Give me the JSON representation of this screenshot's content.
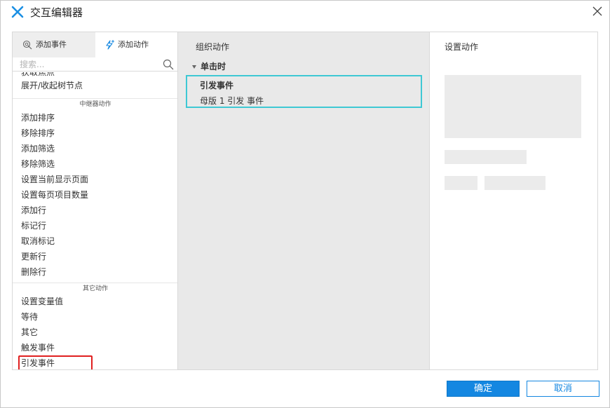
{
  "window": {
    "title": "交互编辑器"
  },
  "left_panel": {
    "tabs": [
      {
        "label": "添加事件",
        "icon": "add-event-icon"
      },
      {
        "label": "添加动作",
        "icon": "add-action-icon"
      }
    ],
    "search": {
      "placeholder": "搜索..."
    },
    "items_top": [
      "获取焦点",
      "展开/收起树节点"
    ],
    "section_repeater": "中继器动作",
    "repeater_items": [
      "添加排序",
      "移除排序",
      "添加筛选",
      "移除筛选",
      "设置当前显示页面",
      "设置每页项目数量",
      "添加行",
      "标记行",
      "取消标记",
      "更新行",
      "删除行"
    ],
    "section_other": "其它动作",
    "other_items": [
      "设置变量值",
      "等待",
      "其它",
      "触发事件",
      "引发事件"
    ]
  },
  "middle_panel": {
    "title": "组织动作",
    "event": "单击时",
    "action": {
      "name": "引发事件",
      "detail": "母版 1 引发 事件"
    }
  },
  "right_panel": {
    "title": "设置动作"
  },
  "footer": {
    "ok_label": "确定",
    "cancel_label": "取消"
  },
  "colors": {
    "accent": "#1487e1",
    "selection_outline": "#3ec8d4",
    "highlight_outline": "#e02020",
    "app_icon": "#1a8fe3"
  }
}
